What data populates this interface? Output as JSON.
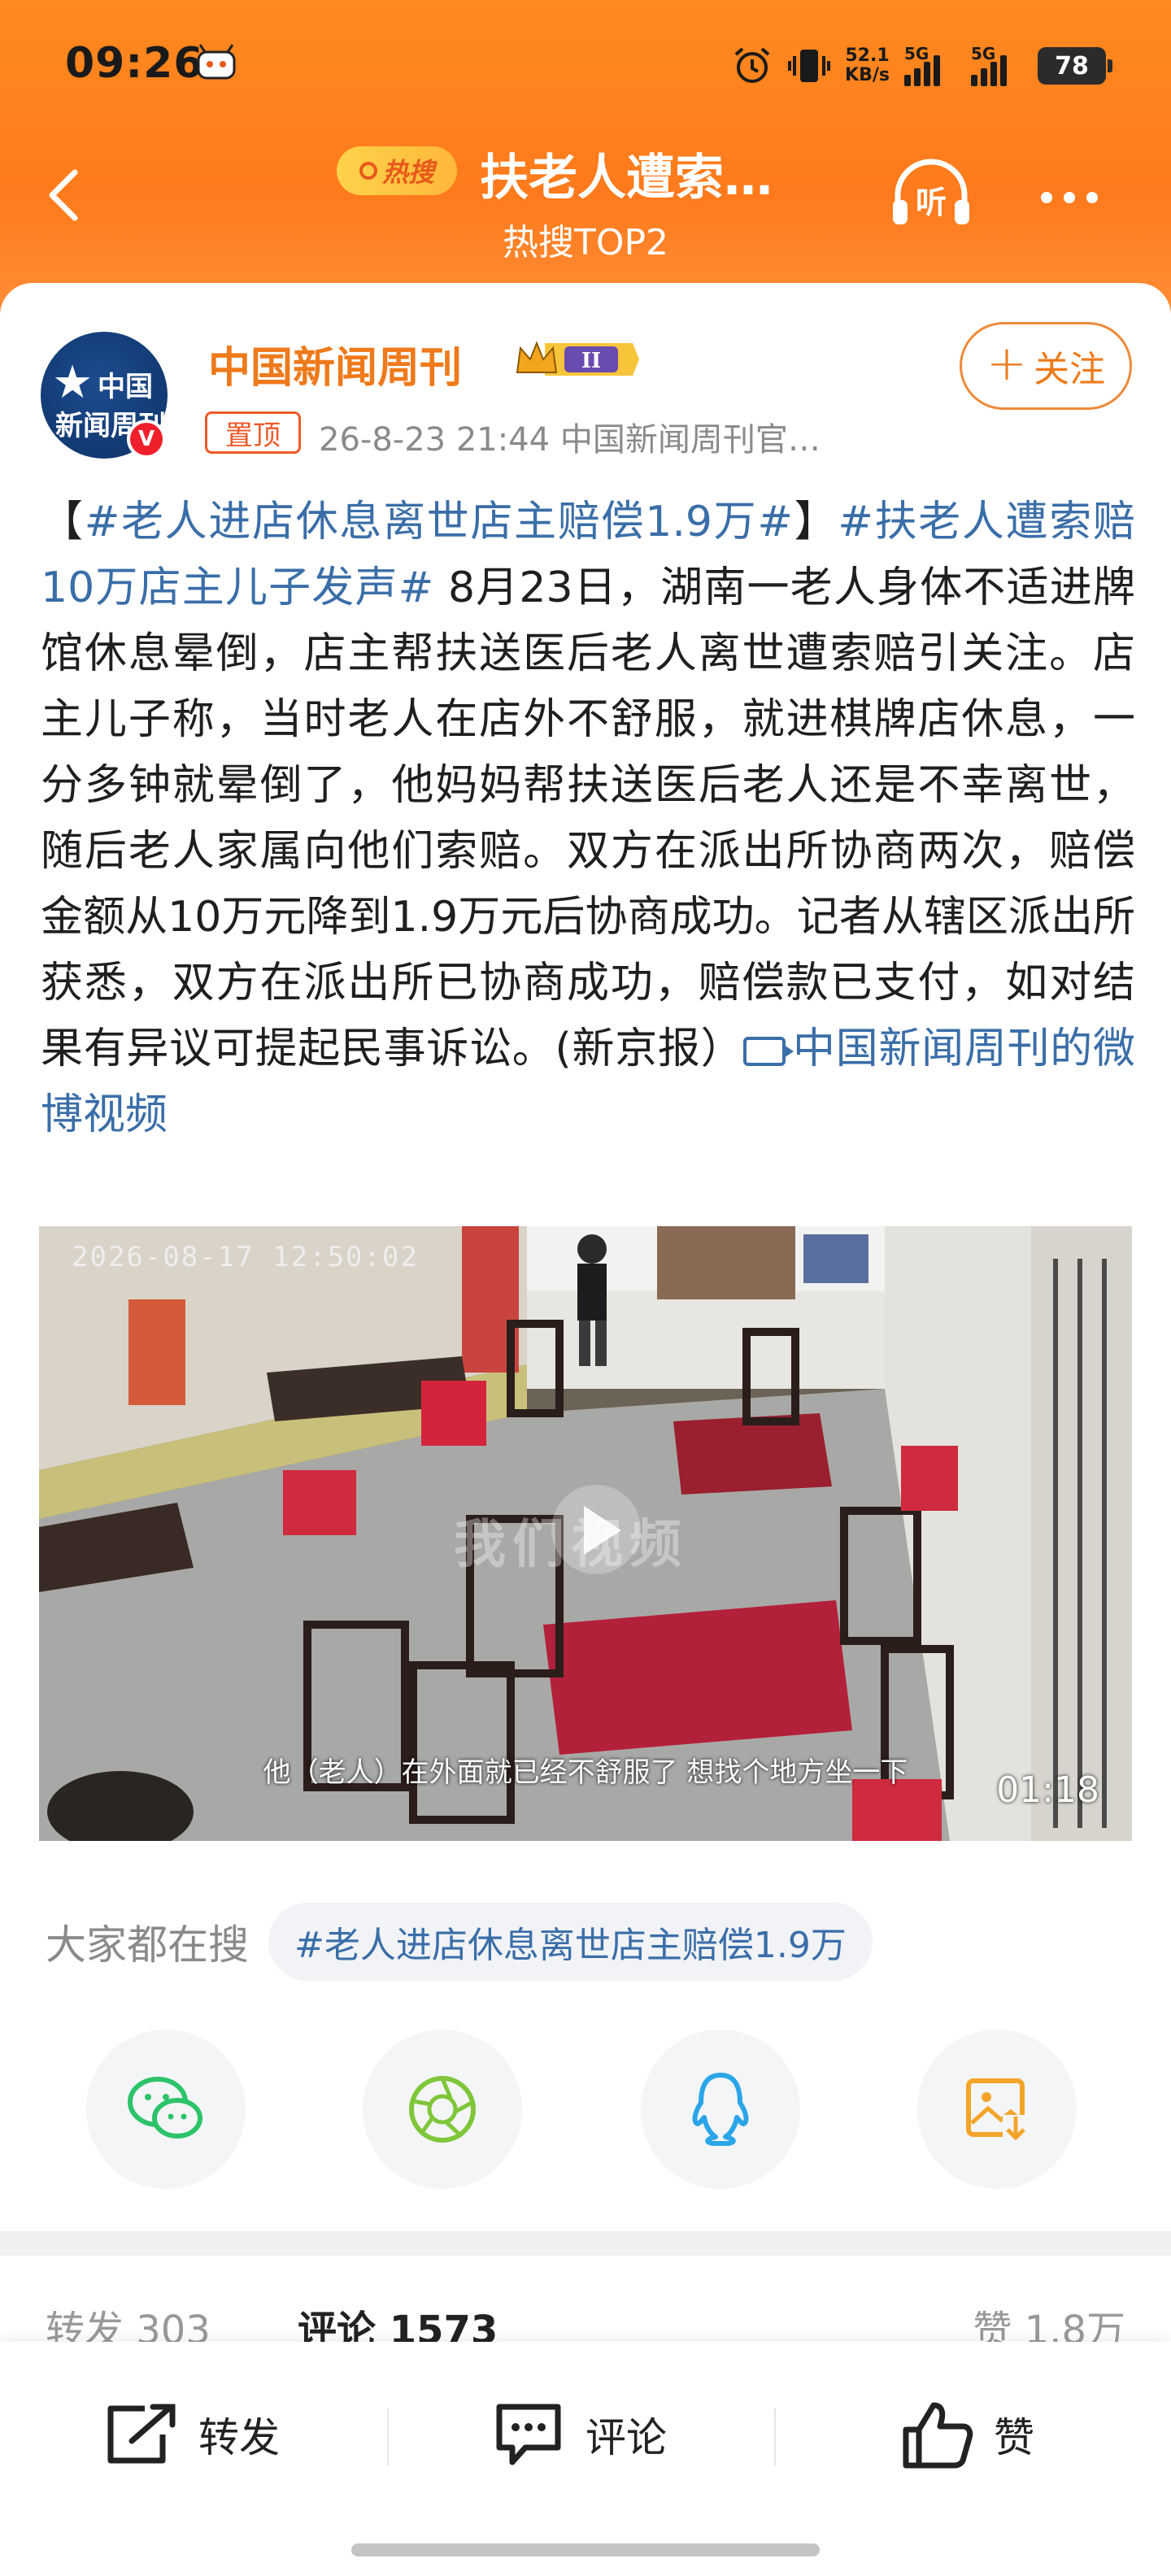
{
  "status_bar": {
    "time": "09:26",
    "net_speed_value": "52.1",
    "net_speed_unit": "KB/s",
    "sim1_label": "5G",
    "sim2_label": "5G",
    "battery": "78"
  },
  "nav": {
    "hot_badge": "热搜",
    "title": "扶老人遭索…",
    "subtitle": "热搜TOP2",
    "listen_label": "听"
  },
  "post": {
    "author": "中国新闻周刊",
    "avatar_line1": "中国",
    "avatar_line2": "新闻周刊",
    "verified_mark": "V",
    "level": "II",
    "pin_label": "置顶",
    "meta": "26-8-23 21:44  中国新闻周刊官…",
    "follow_label": "关注",
    "text_open": "【",
    "tag1": "#老人进店休息离世店主赔偿1.9万#",
    "text_close": "】",
    "tag2": "#扶老人遭索赔10万店主儿子发声#",
    "body": " 8月23日，湖南一老人身体不适进牌馆休息晕倒，店主帮扶送医后老人离世遭索赔引关注。店主儿子称，当时老人在店外不舒服，就进棋牌店休息，一分多钟就晕倒了，他妈妈帮扶送医后老人还是不幸离世，随后老人家属向他们索赔。双方在派出所协商两次，赔偿金额从10万元降到1.9万元后协商成功。记者从辖区派出所获悉，双方在派出所已协商成功，赔偿款已支付，如对结果有异议可提起民事诉讼。(新京报）",
    "video_link": "中国新闻周刊的微博视频"
  },
  "video": {
    "timestamp": "2026-08-17  12:50:02",
    "watermark": "我们视频",
    "subtitle": "他（老人）在外面就已经不舒服了 想找个地方坐一下",
    "duration": "01:18"
  },
  "search": {
    "label": "大家都在搜",
    "chip": "#老人进店休息离世店主赔偿1.9万"
  },
  "share": [
    "wechat-icon",
    "moments-icon",
    "qq-icon",
    "save-image-icon"
  ],
  "stats": {
    "repost": "转发 303",
    "comment": "评论 1573",
    "like": "赞 1.8万"
  },
  "actions": {
    "repost": "转发",
    "comment": "评论",
    "like": "赞"
  },
  "colors": {
    "header_orange": "#ff7a1c",
    "author_orange": "#ee7a1b",
    "link_blue": "#3a6ea8"
  }
}
